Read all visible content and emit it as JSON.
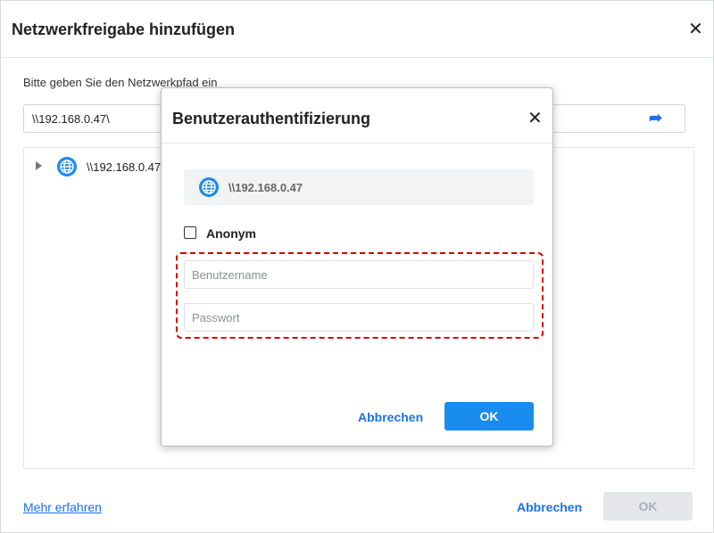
{
  "dialog": {
    "title": "Netzwerkfreigabe hinzufügen",
    "close_glyph": "✕",
    "path_label": "Bitte geben Sie den Netzwerkpfad ein",
    "path_value": "\\\\192.168.0.47\\",
    "go_glyph": "➦",
    "go_icon": "arrow-right-icon",
    "tree": {
      "items": [
        {
          "label": "\\\\192.168.0.47",
          "icon": "globe-icon",
          "expanded": false
        }
      ]
    },
    "more_link": "Mehr erfahren",
    "cancel_label": "Abbrechen",
    "ok_label": "OK"
  },
  "auth_dialog": {
    "title": "Benutzerauthentifizierung",
    "close_glyph": "✕",
    "server_label": "\\\\192.168.0.47",
    "server_icon": "globe-icon",
    "anonymous_label": "Anonym",
    "anonymous_checked": false,
    "username_placeholder": "Benutzername",
    "password_placeholder": "Passwort",
    "username_value": "",
    "password_value": "",
    "cancel_label": "Abbrechen",
    "ok_label": "OK"
  },
  "colors": {
    "accent": "#1a73e8",
    "primary_button": "#1a8cf0",
    "disabled_button": "#e5e7ea",
    "highlight": "#d40000",
    "globe": "#1a8cf0"
  }
}
